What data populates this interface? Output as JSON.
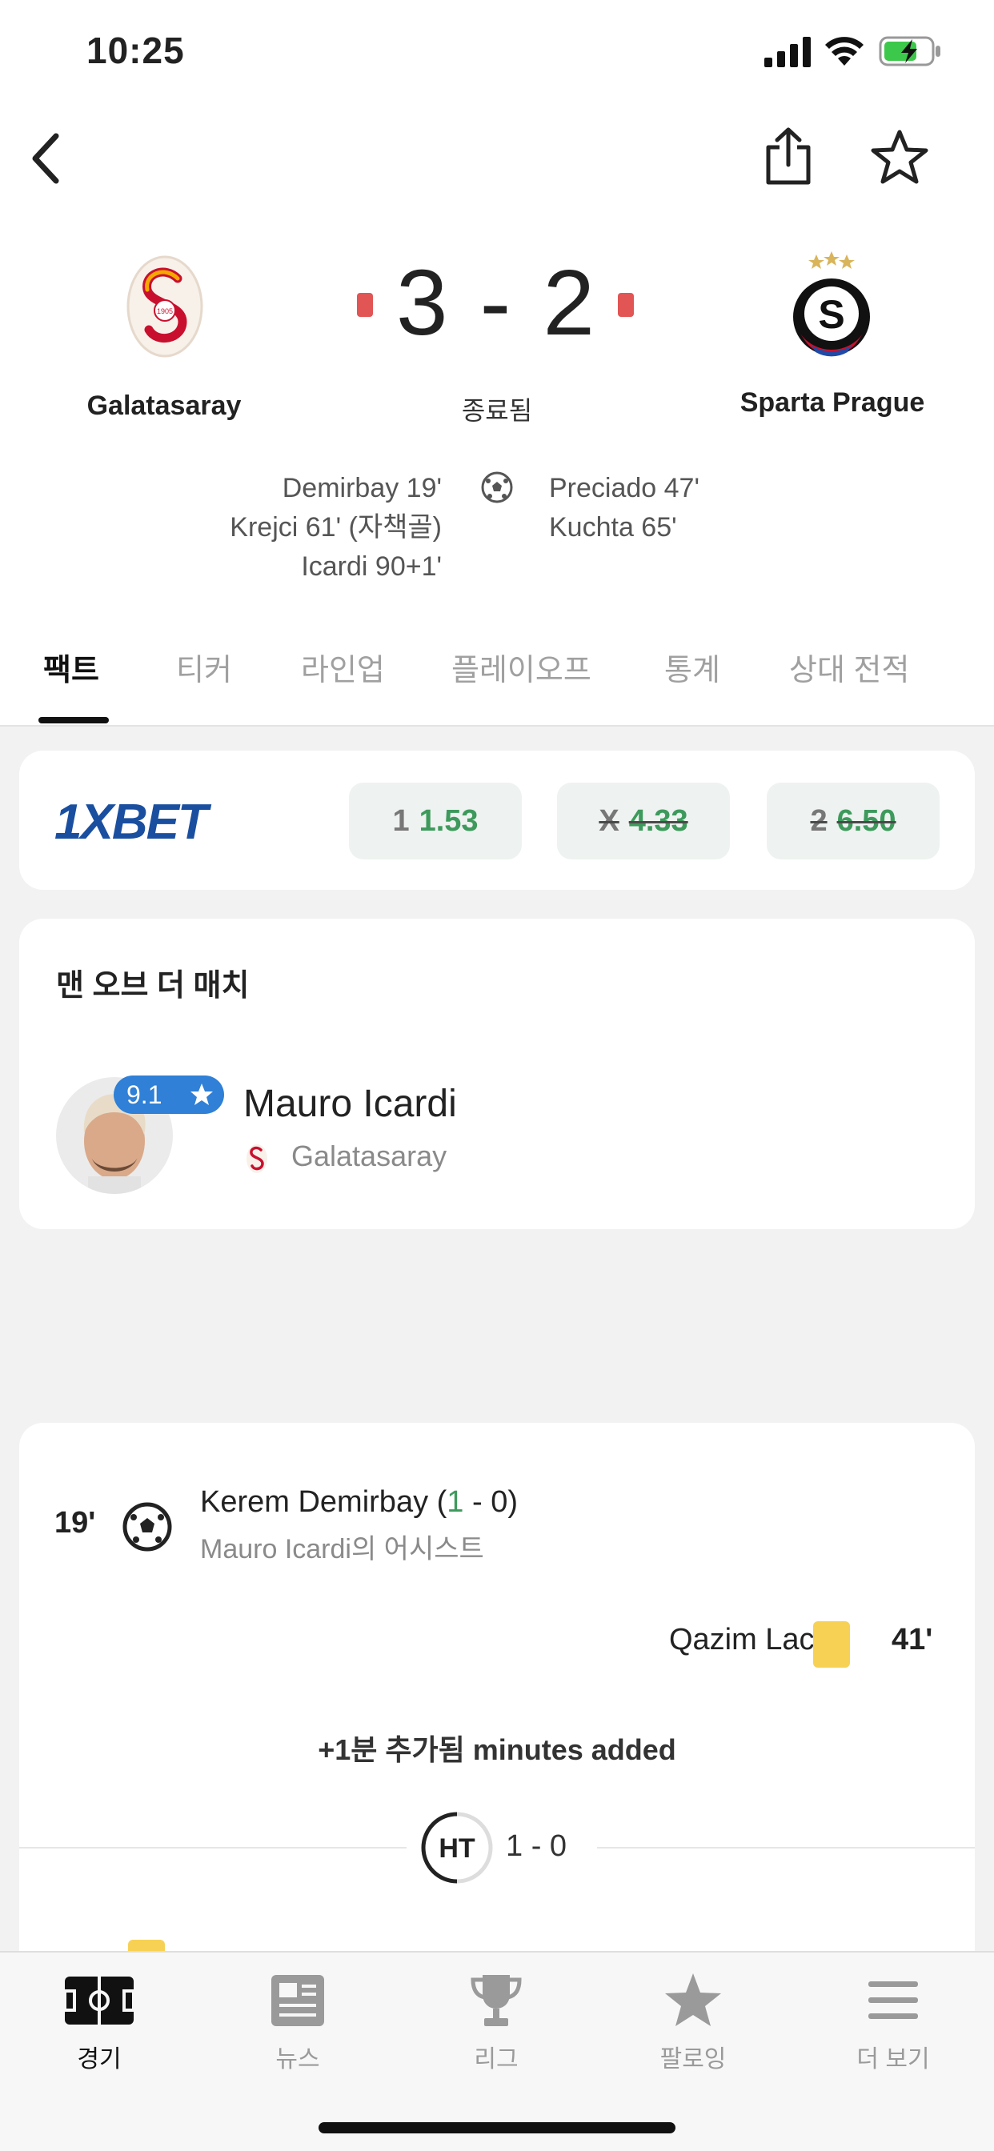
{
  "status_bar": {
    "time": "10:25"
  },
  "match": {
    "home": {
      "name": "Galatasaray",
      "crest_year": "1905"
    },
    "away": {
      "name": "Sparta Prague"
    },
    "score": "3 - 2",
    "status": "종료됨",
    "home_scorers": [
      "Demirbay 19'",
      "Krejci 61' (자책골)",
      "Icardi 90+1'"
    ],
    "away_scorers": [
      "Preciado 47'",
      "Kuchta 65'"
    ]
  },
  "tabs": [
    {
      "label": "팩트",
      "active": true
    },
    {
      "label": "티커"
    },
    {
      "label": "라인업"
    },
    {
      "label": "플레이오프"
    },
    {
      "label": "통계"
    },
    {
      "label": "상대 전적"
    }
  ],
  "odds": {
    "brand": "1XBET",
    "items": [
      {
        "label": "1",
        "value": "1.53",
        "struck": false
      },
      {
        "label": "X",
        "value": "4.33",
        "struck": true
      },
      {
        "label": "2",
        "value": "6.50",
        "struck": true
      }
    ]
  },
  "motm": {
    "title": "맨 오브 더 매치",
    "player": "Mauro Icardi",
    "team": "Galatasaray",
    "rating": "9.1"
  },
  "events": {
    "goal": {
      "minute": "19'",
      "player": "Kerem Demirbay",
      "score_open": "(",
      "score_home": "1",
      "score_rest": " - 0)",
      "assist": "Mauro Icardi의 어시스트"
    },
    "card": {
      "minute": "41'",
      "player": "Qazim Laci",
      "type": "yellow"
    },
    "added_time": "+1분 추가됨 minutes added",
    "halftime": {
      "label": "HT",
      "score": "1 - 0"
    }
  },
  "bottom_nav": [
    {
      "label": "경기",
      "icon": "pitch-icon",
      "active": true
    },
    {
      "label": "뉴스",
      "icon": "news-icon"
    },
    {
      "label": "리그",
      "icon": "trophy-icon"
    },
    {
      "label": "팔로잉",
      "icon": "star-icon"
    },
    {
      "label": "더 보기",
      "icon": "menu-icon"
    }
  ],
  "colors": {
    "accent_green": "#3e9a5c",
    "red_card": "#e25555",
    "yellow_card": "#f7d154",
    "rating_blue": "#2f80d6",
    "brand_blue": "#1a4fa0"
  }
}
